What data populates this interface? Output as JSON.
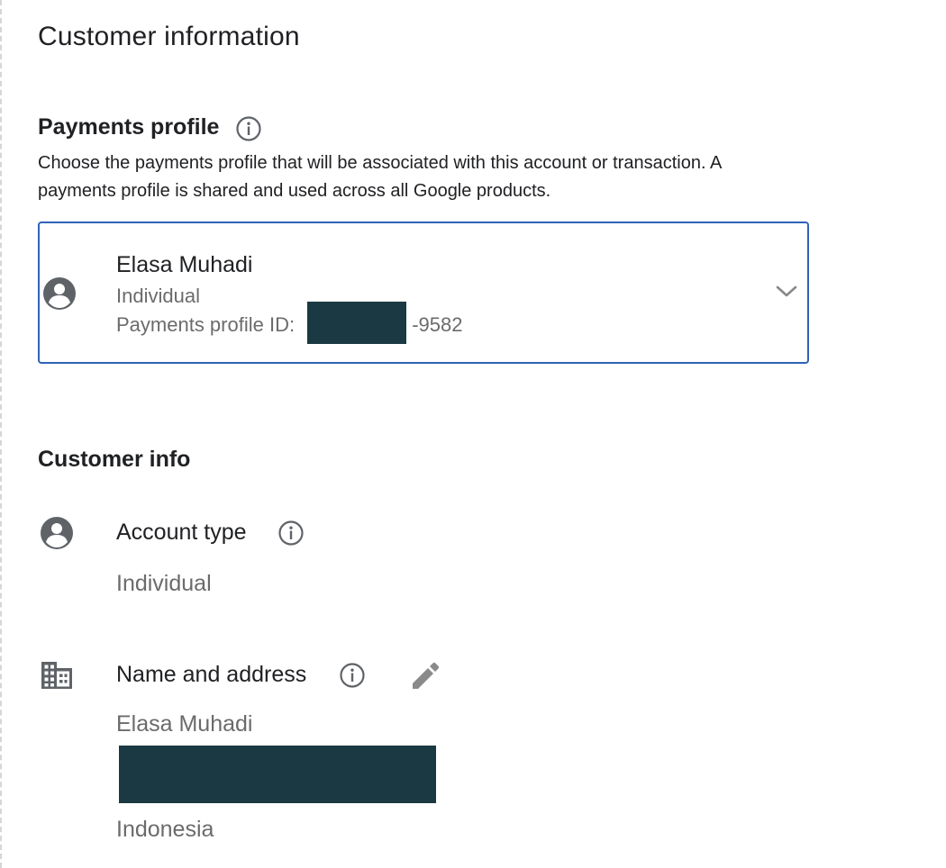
{
  "page_title": "Customer information",
  "payments_profile": {
    "heading": "Payments profile",
    "description": "Choose the payments profile that will be associated with this account or transaction. A payments profile is shared and used across all Google products.",
    "selected": {
      "name": "Elasa Muhadi",
      "type": "Individual",
      "id_label": "Payments profile ID: ",
      "id_suffix": "-9582"
    }
  },
  "customer_info": {
    "heading": "Customer info",
    "account_type": {
      "label": "Account type",
      "value": "Individual"
    },
    "name_and_address": {
      "label": "Name and address",
      "name": "Elasa Muhadi",
      "country": "Indonesia"
    }
  },
  "icons": {
    "info": "info-circle-icon",
    "person": "account-circle-icon",
    "building": "business-icon",
    "edit": "pencil-icon",
    "dropdown": "chevron-down-icon"
  },
  "colors": {
    "accent_border": "#2f63b6",
    "redaction": "#1b3942",
    "secondary_text": "#6b6b6b",
    "icon_gray": "#5f6368"
  }
}
